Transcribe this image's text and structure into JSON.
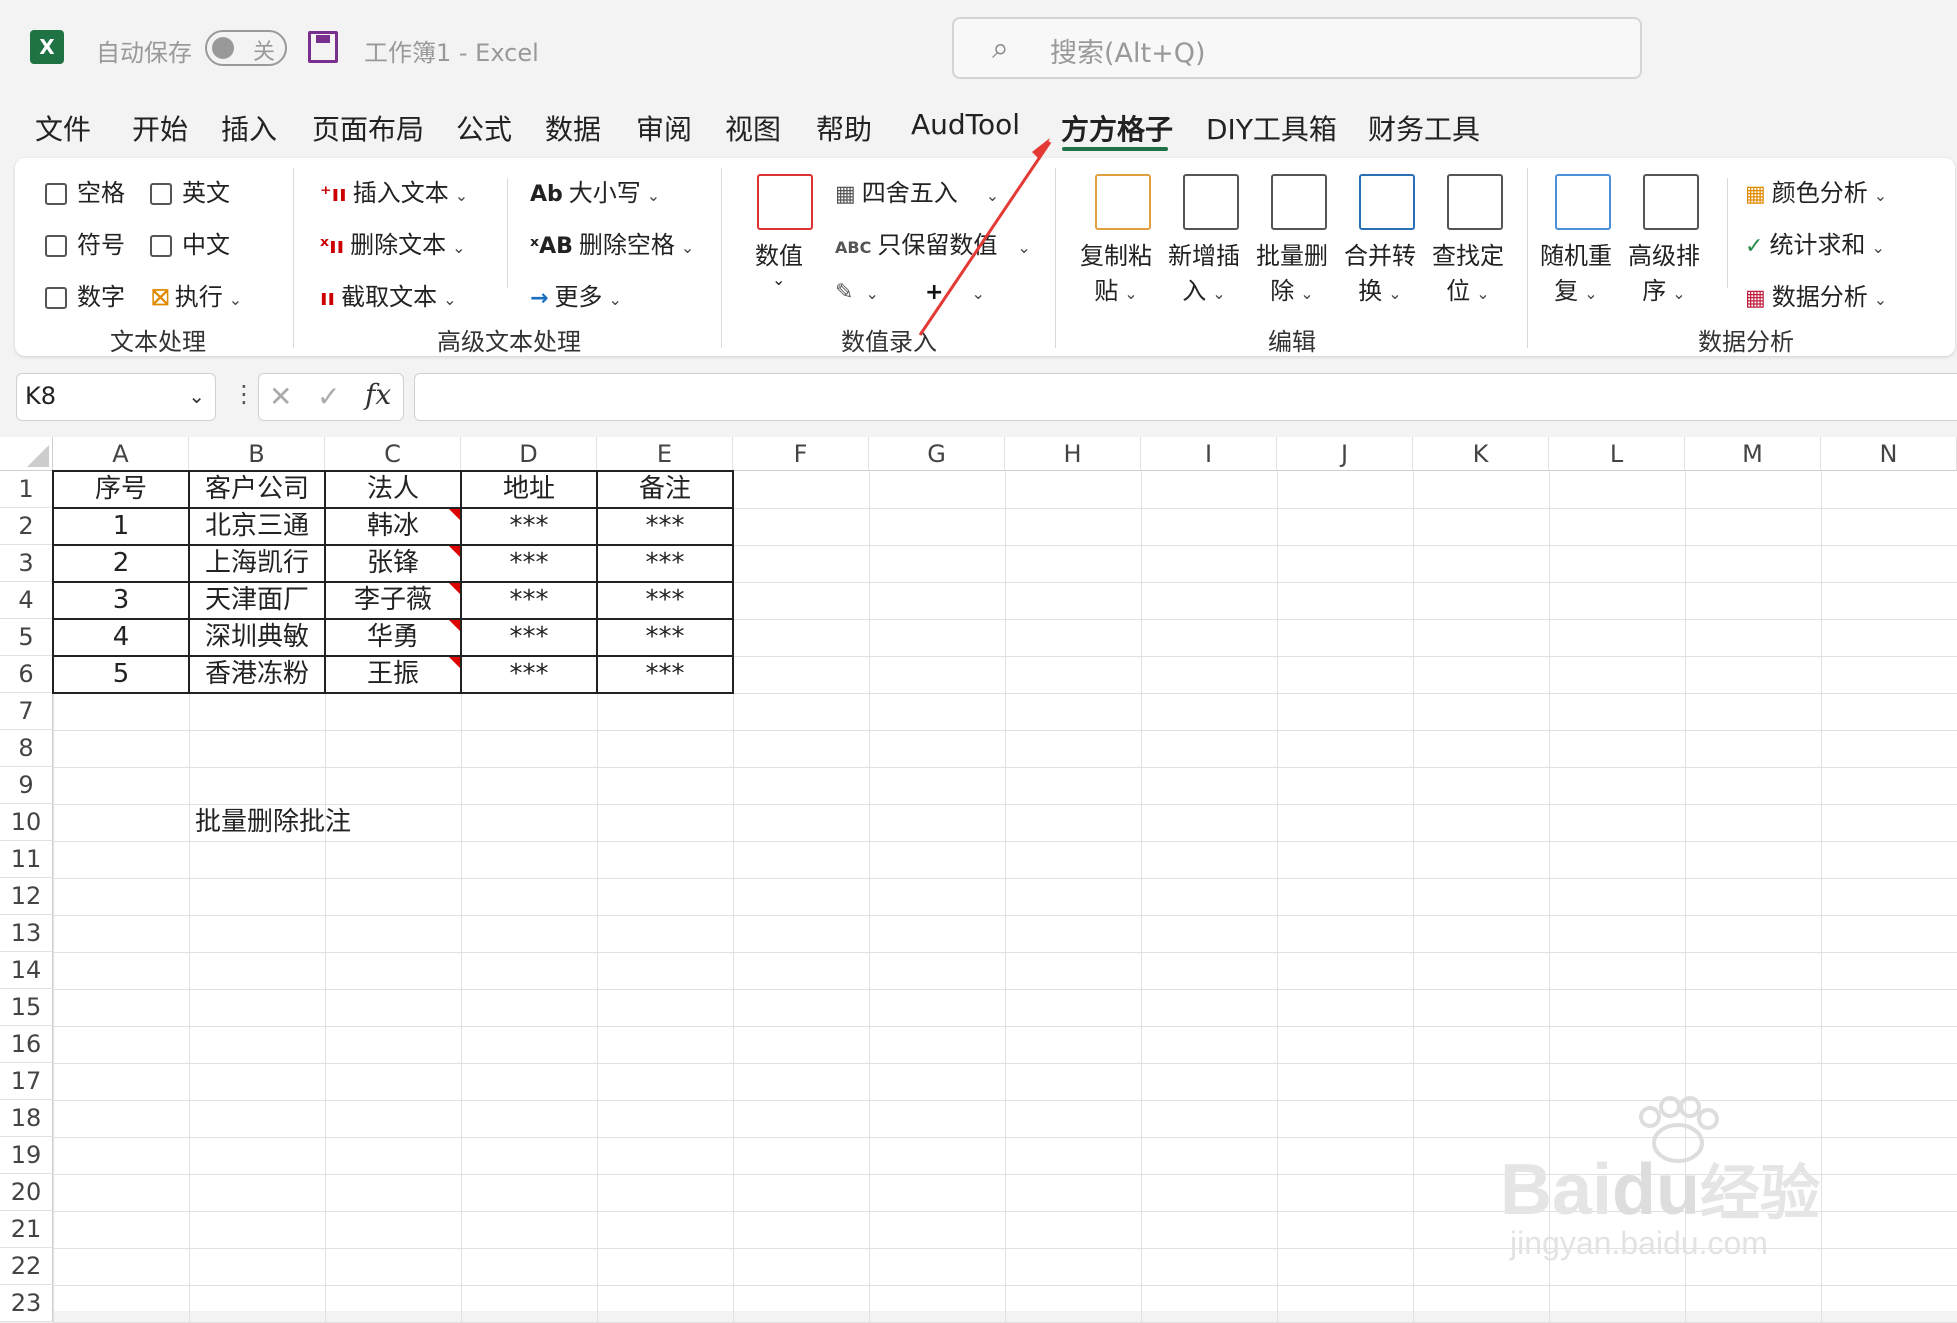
{
  "titlebar": {
    "autosave_label": "自动保存",
    "autosave_state": "关",
    "doc_title": "工作簿1  -  Excel",
    "search_placeholder": "搜索(Alt+Q)"
  },
  "tabs": [
    "文件",
    "开始",
    "插入",
    "页面布局",
    "公式",
    "数据",
    "审阅",
    "视图",
    "帮助",
    "AudTool",
    "方方格子",
    "DIY工具箱",
    "财务工具"
  ],
  "active_tab": "方方格子",
  "ribbon": {
    "text_group": {
      "label": "文本处理",
      "checkboxes": [
        "空格",
        "英文",
        "符号",
        "中文",
        "数字"
      ],
      "execute": "执行"
    },
    "adv_text_group": {
      "label": "高级文本处理",
      "insert_text": "插入文本",
      "delete_text": "删除文本",
      "extract_text": "截取文本",
      "case": "大小写",
      "delete_space": "删除空格",
      "more": "更多"
    },
    "value_group": {
      "label": "数值录入",
      "value": "数值",
      "round": "四舍五入",
      "keep_value": "只保留数值"
    },
    "edit_group": {
      "label": "编辑",
      "copy_paste": [
        "复制粘",
        "贴"
      ],
      "add_insert": [
        "新增插",
        "入"
      ],
      "batch_delete": [
        "批量删",
        "除"
      ],
      "merge_convert": [
        "合并转",
        "换"
      ],
      "find_locate": [
        "查找定",
        "位"
      ]
    },
    "analysis_group": {
      "label": "数据分析",
      "random_repeat": [
        "随机重",
        "复"
      ],
      "advanced_sort": [
        "高级排",
        "序"
      ],
      "color_analysis": "颜色分析",
      "stat_sum": "统计求和",
      "data_analysis": "数据分析"
    }
  },
  "formula_bar": {
    "name_box": "K8",
    "fx": "fx",
    "formula": ""
  },
  "sheet": {
    "columns": [
      "A",
      "B",
      "C",
      "D",
      "E",
      "F",
      "G",
      "H",
      "I",
      "J",
      "K",
      "L",
      "M",
      "N"
    ],
    "rows": [
      "1",
      "2",
      "3",
      "4",
      "5",
      "6",
      "7",
      "8",
      "9",
      "10",
      "11",
      "12",
      "13",
      "14",
      "15",
      "16",
      "17",
      "18",
      "19",
      "20",
      "21",
      "22",
      "23"
    ],
    "table_header": [
      "序号",
      "客户公司",
      "法人",
      "地址",
      "备注"
    ],
    "table_rows": [
      [
        "1",
        "北京三通",
        "韩冰",
        "***",
        "***"
      ],
      [
        "2",
        "上海凯行",
        "张锋",
        "***",
        "***"
      ],
      [
        "3",
        "天津面厂",
        "李子薇",
        "***",
        "***"
      ],
      [
        "4",
        "深圳典敏",
        "华勇",
        "***",
        "***"
      ],
      [
        "5",
        "香港冻粉",
        "王振",
        "***",
        "***"
      ]
    ],
    "note_cell": "批量删除批注"
  },
  "watermark": {
    "brand": "Bai",
    "brand2": "du",
    "suffix": "经验",
    "url": "jingyan.baidu.com"
  },
  "colors": {
    "accent": "#1f7244",
    "arrow": "#e53935",
    "comment": "#d00000"
  }
}
